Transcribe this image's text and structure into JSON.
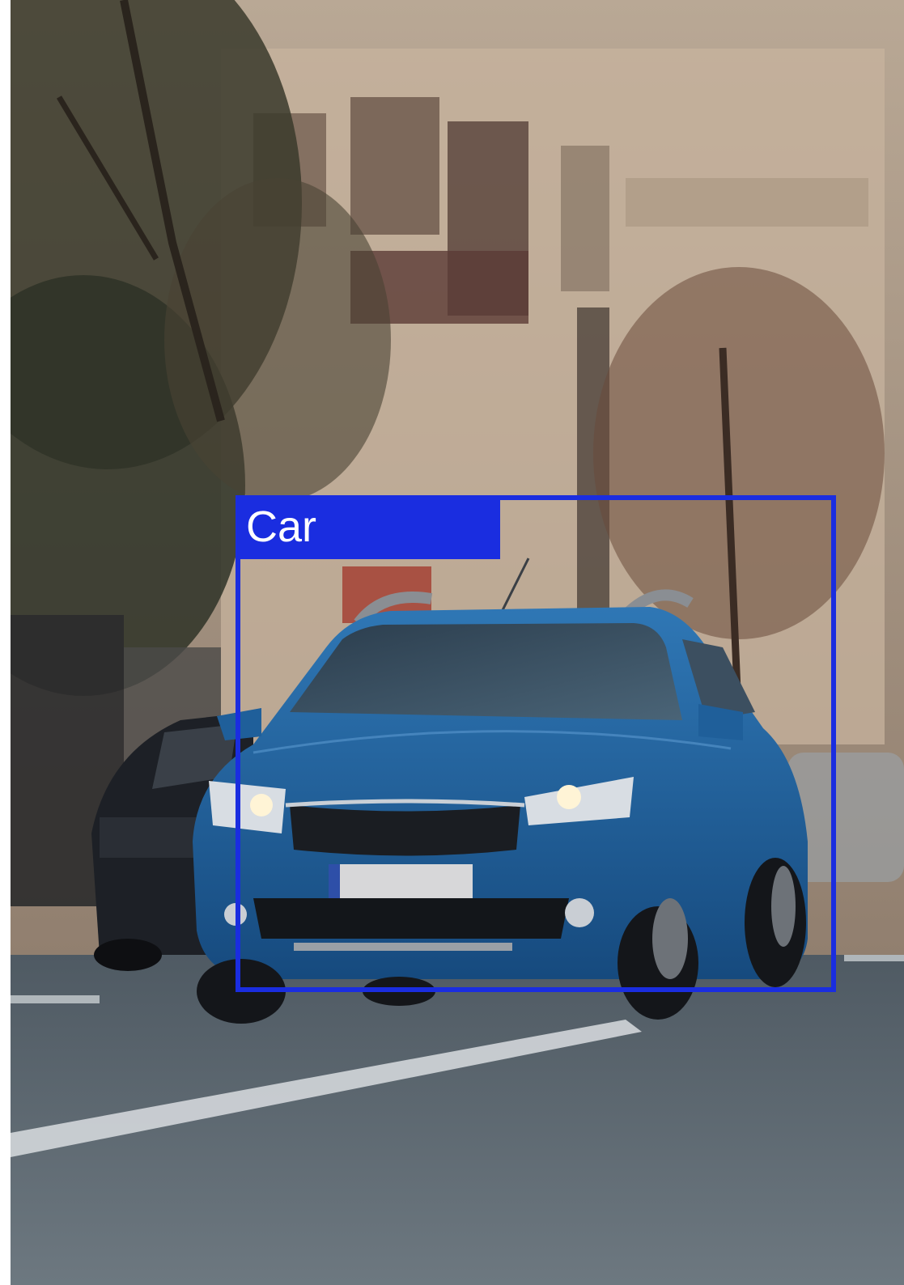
{
  "detection": {
    "label": "Car",
    "box_color": "#1a2de0",
    "label_text_color": "#ffffff"
  },
  "scene": {
    "icons": [
      "street-photo",
      "blue-hatchback-car",
      "dark-parked-car",
      "trees",
      "apartment-building",
      "road-lane-marking"
    ]
  }
}
